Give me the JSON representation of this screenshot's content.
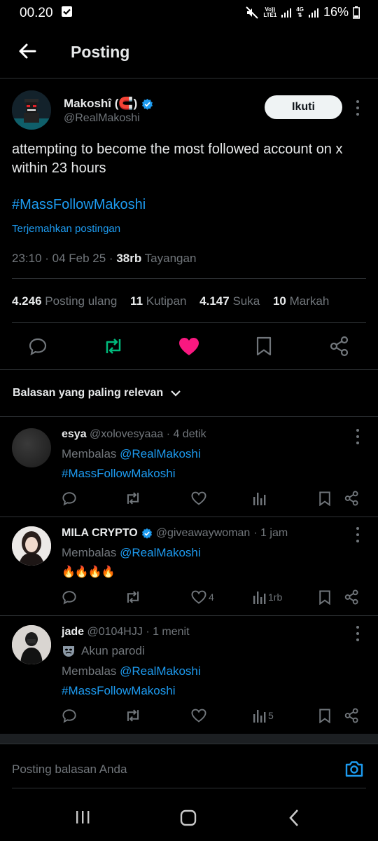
{
  "status_bar": {
    "time": "00.20",
    "volte": "Vo))",
    "lte": "LTE1",
    "net": "4G",
    "battery": "16%"
  },
  "header": {
    "title": "Posting"
  },
  "post": {
    "author_name": "Makoshî (🧲)",
    "handle": "@RealMakoshi",
    "follow_label": "Ikuti",
    "text_line1": "attempting to become the most followed account on x",
    "text_line2": "within 23 hours",
    "hashtag": "#MassFollowMakoshi",
    "translate": "Terjemahkan postingan",
    "timestamp": "23:10 · 04 Feb 25 · ",
    "views_count": "38rb",
    "views_label": "Tayangan",
    "stats": {
      "reposts_count": "4.246",
      "reposts_label": "Posting ulang",
      "quotes_count": "11",
      "quotes_label": "Kutipan",
      "likes_count": "4.147",
      "likes_label": "Suka",
      "bookmarks_count": "10",
      "bookmarks_label": "Markah"
    }
  },
  "replies_section": {
    "sort_label": "Balasan yang paling relevan"
  },
  "replies": [
    {
      "name": "esya",
      "handle": "@xolovesyaaa",
      "time": "· 4 detik",
      "replying_prefix": "Membalas ",
      "replying_to": "@RealMakoshi",
      "content": "#MassFollowMakoshi",
      "likes": "",
      "views": ""
    },
    {
      "name": "MILA CRYPTO",
      "handle": "@giveawaywoman",
      "time": "· 1 jam",
      "replying_prefix": "Membalas ",
      "replying_to": "@RealMakoshi",
      "content": "🔥🔥🔥🔥",
      "likes": "4",
      "views": "1rb"
    },
    {
      "name": "jade",
      "handle": "@0104HJJ",
      "time": "· 1 menit",
      "label": "Akun parodi",
      "replying_prefix": "Membalas ",
      "replying_to": "@RealMakoshi",
      "content": "#MassFollowMakoshi",
      "likes": "",
      "views": "5"
    }
  ],
  "composer": {
    "placeholder": "Posting balasan Anda"
  },
  "colors": {
    "accent": "#1d9bf0",
    "like": "#f91880",
    "repost": "#00ba7c",
    "muted": "#71767b"
  }
}
